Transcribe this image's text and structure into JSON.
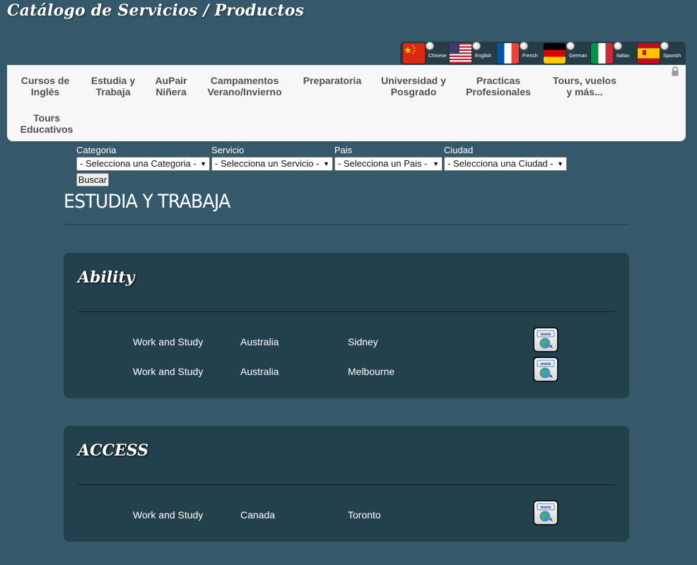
{
  "site": {
    "title": "Catálogo de Servicios / Productos"
  },
  "languages": [
    {
      "label": "Chinese",
      "icon": "china-flag-icon"
    },
    {
      "label": "English",
      "icon": "usa-flag-icon"
    },
    {
      "label": "French",
      "icon": "france-flag-icon"
    },
    {
      "label": "German",
      "icon": "germany-flag-icon"
    },
    {
      "label": "Italian",
      "icon": "italy-flag-icon"
    },
    {
      "label": "Spanish",
      "icon": "spain-flag-icon"
    }
  ],
  "nav": {
    "items": [
      {
        "line1": "Cursos de",
        "line2": "Inglés"
      },
      {
        "line1": "Estudia y",
        "line2": "Trabaja"
      },
      {
        "line1": "AuPair",
        "line2": "Niñera"
      },
      {
        "line1": "Campamentos",
        "line2": "Verano/Invierno"
      },
      {
        "line1": "Preparatoria",
        "line2": ""
      },
      {
        "line1": "Universidad y",
        "line2": "Posgrado"
      },
      {
        "line1": "Practicas",
        "line2": "Profesionales"
      },
      {
        "line1": "Tours, vuelos",
        "line2": "y más..."
      },
      {
        "line1": "Tours",
        "line2": "Educativos"
      }
    ],
    "lock_icon": "lock-icon"
  },
  "filters": {
    "categoria": {
      "label": "Categoria",
      "value": "- Selecciona una Categoria -"
    },
    "servicio": {
      "label": "Servicio",
      "value": "- Selecciona un Servicio -"
    },
    "pais": {
      "label": "Pais",
      "value": "- Selecciona un Pais -"
    },
    "ciudad": {
      "label": "Ciudad",
      "value": "- Selecciona una Ciudad -"
    },
    "buscar_label": "Buscar"
  },
  "section": {
    "heading": "ESTUDIA Y TRABAJA"
  },
  "providers": [
    {
      "name": "Ability",
      "rows": [
        {
          "service": "Work and Study",
          "country": "Australia",
          "city": "Sidney",
          "link_icon": "www-globe-icon"
        },
        {
          "service": "Work and Study",
          "country": "Australia",
          "city": "Melbourne",
          "link_icon": "www-globe-icon"
        }
      ]
    },
    {
      "name": "ACCESS",
      "rows": [
        {
          "service": "Work and Study",
          "country": "Canada",
          "city": "Toronto",
          "link_icon": "www-globe-icon"
        }
      ]
    }
  ],
  "colors": {
    "background": "#35596a",
    "card": "#23404d",
    "nav_bg": "#f7f7f7",
    "nav_text": "#505050"
  }
}
